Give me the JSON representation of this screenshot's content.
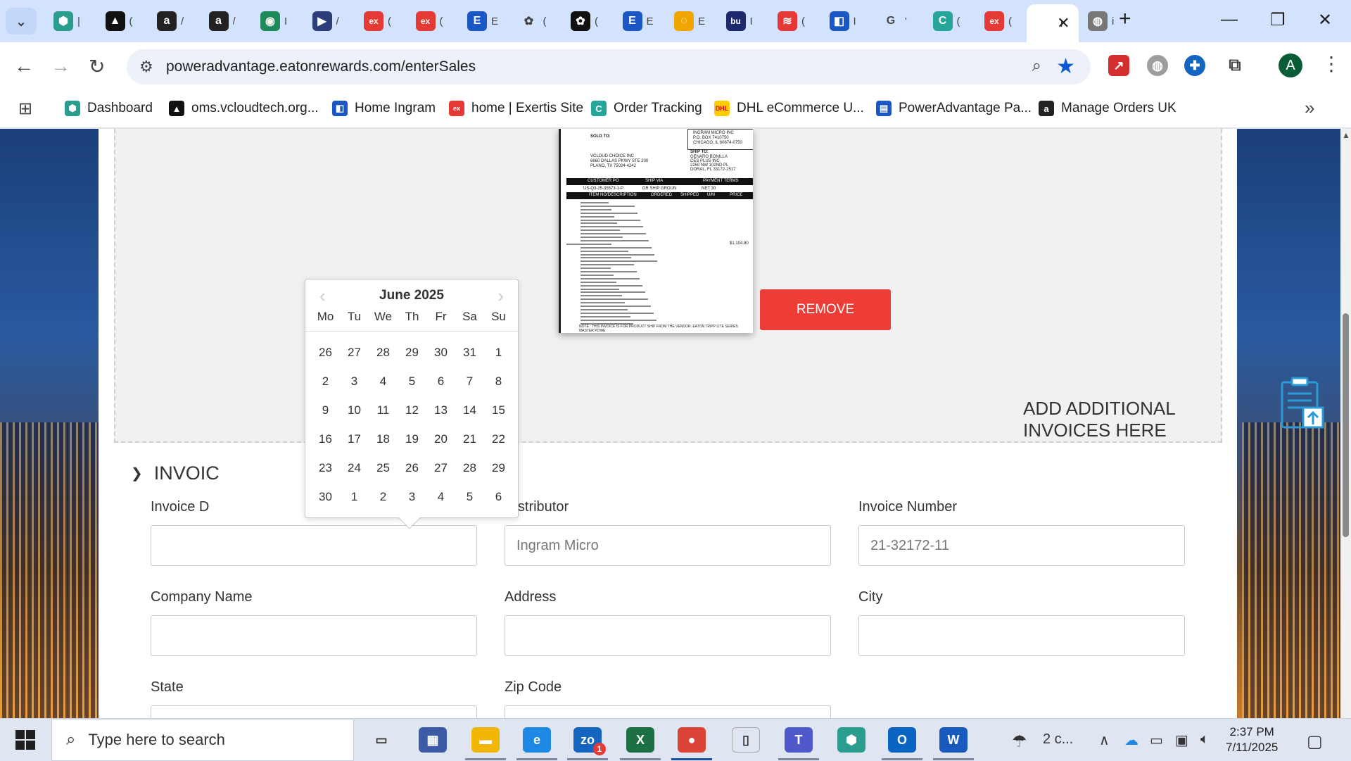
{
  "tabs": [
    {
      "title": "|",
      "icon": "hexagon-icon",
      "color": "#2a9d8f"
    },
    {
      "title": "(",
      "icon": "triangle-logo-icon",
      "color": "#111111"
    },
    {
      "title": "/",
      "icon": "amazon-icon",
      "color": "#222222"
    },
    {
      "title": "/",
      "icon": "amazon-icon",
      "color": "#222222"
    },
    {
      "title": "I",
      "icon": "green-circle-icon",
      "color": "#1e8a5a"
    },
    {
      "title": "/",
      "icon": "play-arrow-icon",
      "color": "#2c3e7a"
    },
    {
      "title": "(",
      "icon": "exertis-icon",
      "color": "#e53935"
    },
    {
      "title": "(",
      "icon": "exertis-icon",
      "color": "#e53935"
    },
    {
      "title": "E",
      "icon": "e-logo-icon",
      "color": "#1a56c4"
    },
    {
      "title": "(",
      "icon": "openai-icon",
      "color": "#ffffff"
    },
    {
      "title": "(",
      "icon": "openai-icon",
      "color": "#111111"
    },
    {
      "title": "E",
      "icon": "e-logo-icon",
      "color": "#1a56c4"
    },
    {
      "title": "E",
      "icon": "lightbulb-icon",
      "color": "#f0a500"
    },
    {
      "title": "I",
      "icon": "bu-icon",
      "color": "#1c2a6b"
    },
    {
      "title": "(",
      "icon": "stack-icon",
      "color": "#e53935"
    },
    {
      "title": "I",
      "icon": "ingram-icon",
      "color": "#1a56c4"
    },
    {
      "title": "'",
      "icon": "google-icon",
      "color": "#ffffff"
    },
    {
      "title": "(",
      "icon": "c-circle-icon",
      "color": "#26a69a"
    },
    {
      "title": "(",
      "icon": "exertis-icon",
      "color": "#e53935"
    },
    {
      "title": "I",
      "icon": "blank-page-icon",
      "color": "#ffffff",
      "active": true
    },
    {
      "title": "i",
      "icon": "globe-icon",
      "color": "#777777"
    }
  ],
  "address": {
    "url": "poweradvantage.eatonrewards.com/enterSales"
  },
  "bookmarks": [
    {
      "label": "Dashboard",
      "icon": "hexagon-icon",
      "color": "#2a9d8f"
    },
    {
      "label": "oms.vcloudtech.org...",
      "icon": "triangle-logo-icon",
      "color": "#111111"
    },
    {
      "label": "Home Ingram",
      "icon": "ingram-icon",
      "color": "#1a56c4"
    },
    {
      "label": "home | Exertis Site",
      "icon": "exertis-icon",
      "color": "#e53935"
    },
    {
      "label": "Order Tracking",
      "icon": "c-circle-icon",
      "color": "#26a69a"
    },
    {
      "label": "DHL eCommerce U...",
      "icon": "dhl-icon",
      "color": "#ffcc00"
    },
    {
      "label": "PowerAdvantage Pa...",
      "icon": "doc-icon",
      "color": "#1a56c4"
    },
    {
      "label": "Manage Orders UK",
      "icon": "amazon-icon",
      "color": "#222222"
    }
  ],
  "upload": {
    "remove_label": "REMOVE",
    "add_more_label": "ADD ADDITIONAL INVOICES HERE"
  },
  "invoice_doc": {
    "sold_to": "SOLD TO:",
    "ship_to": "SHIP TO:",
    "vendor_lines": [
      "INGRAM MICRO INC",
      "P.O. BOX 7410750",
      "CHICAGO, IL 60674-0750"
    ],
    "buyer_lines": [
      "VCLOUD CHOICE INC",
      "6660 DALLAS PKWY STE 200",
      "PLANO, TX 75024-4242"
    ],
    "ship_lines": [
      "GENARO BONILLA",
      "CES PLUS INC",
      "2250 NW 102ND PL",
      "DORAL, FL 33172-2517"
    ],
    "headers": [
      "CUSTOMER PO",
      "SHIP VIA",
      "PAYMENT TERMS"
    ],
    "row": [
      "US-Q3-25-35573-1-P",
      "DR SHIP GROUN",
      "NET 30"
    ],
    "item_headers": [
      "ITEM NO/DESCRIPTION",
      "ORDERED",
      "SHIPPED",
      "U/M",
      "PRICE"
    ],
    "amount": "$1,104.80",
    "footer_note": "NOTE : THIS INVOICE IS FOR PRODUCT SHIP FROM THE VENDOR: EATON TRIPP LITE SERIES MASTER POWE"
  },
  "section": {
    "title": "INVOIC"
  },
  "form": {
    "invoice_date_label": "Invoice D",
    "invoice_date_value": "",
    "distributor_label": "Distributor",
    "distributor_value": "Ingram Micro",
    "invoice_number_label": "Invoice Number",
    "invoice_number_value": "21-32172-11",
    "company_label": "Company Name",
    "company_value": "",
    "address_label": "Address",
    "address_value": "",
    "city_label": "City",
    "city_value": "",
    "state_label": "State",
    "zip_label": "Zip Code"
  },
  "datepicker": {
    "month_label": "June 2025",
    "weekdays": [
      "Mo",
      "Tu",
      "We",
      "Th",
      "Fr",
      "Sa",
      "Su"
    ],
    "weeks": [
      [
        "26",
        "27",
        "28",
        "29",
        "30",
        "31",
        "1"
      ],
      [
        "2",
        "3",
        "4",
        "5",
        "6",
        "7",
        "8"
      ],
      [
        "9",
        "10",
        "11",
        "12",
        "13",
        "14",
        "15"
      ],
      [
        "16",
        "17",
        "18",
        "19",
        "20",
        "21",
        "22"
      ],
      [
        "23",
        "24",
        "25",
        "26",
        "27",
        "28",
        "29"
      ],
      [
        "30",
        "1",
        "2",
        "3",
        "4",
        "5",
        "6"
      ]
    ]
  },
  "taskbar": {
    "search_placeholder": "Type here to search",
    "weather": "2 c...",
    "time": "2:37 PM",
    "date": "7/11/2025",
    "apps": [
      {
        "name": "task-view-icon",
        "glyph": "▭"
      },
      {
        "name": "calculator-icon",
        "glyph": "▦",
        "color": "#3b5ba5"
      },
      {
        "name": "file-explorer-icon",
        "glyph": "▬",
        "color": "#f2b705"
      },
      {
        "name": "edge-icon",
        "glyph": "e",
        "color": "#1e88e5"
      },
      {
        "name": "zoho-icon",
        "glyph": "zo",
        "color": "#1565c0",
        "badge": "1"
      },
      {
        "name": "excel-icon",
        "glyph": "X",
        "color": "#1d7044"
      },
      {
        "name": "chrome-icon",
        "glyph": "●",
        "color": "#db4437"
      },
      {
        "name": "notepad-icon",
        "glyph": "▯",
        "color": "#ffffff"
      },
      {
        "name": "teams-icon",
        "glyph": "T",
        "color": "#5059c9"
      },
      {
        "name": "hexagon-app-icon",
        "glyph": "⬢",
        "color": "#2a9d8f"
      },
      {
        "name": "outlook-icon",
        "glyph": "O",
        "color": "#0a64c2"
      },
      {
        "name": "word-icon",
        "glyph": "W",
        "color": "#185abd"
      }
    ]
  }
}
